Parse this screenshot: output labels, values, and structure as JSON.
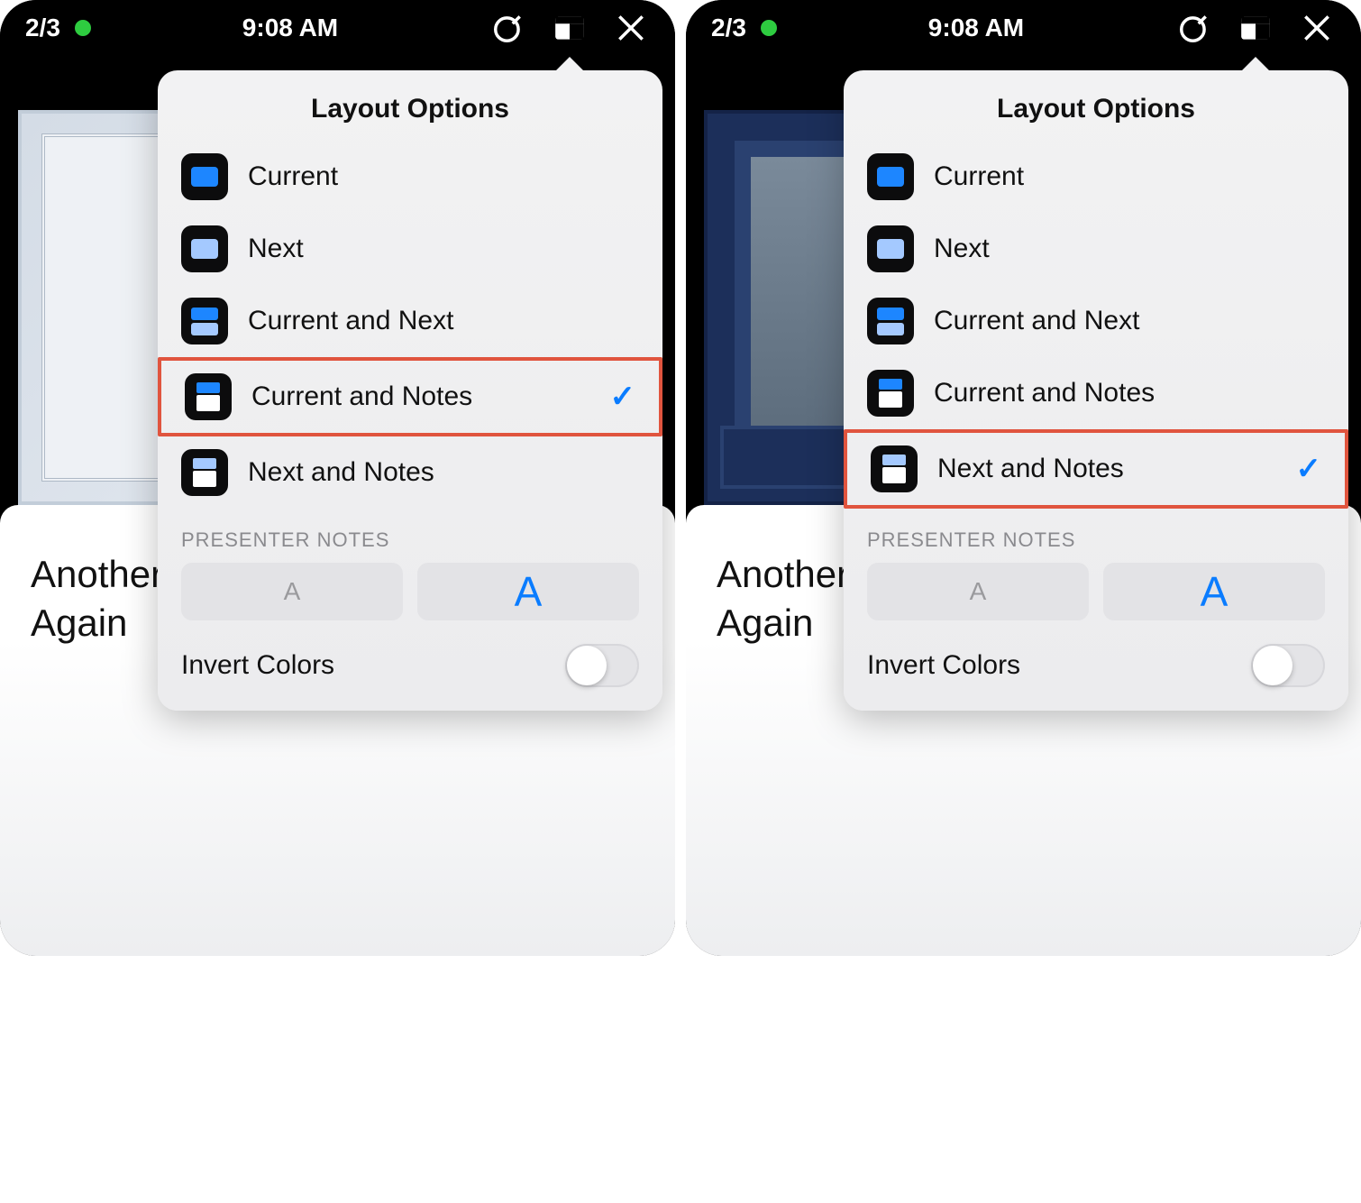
{
  "statusbar": {
    "slide_counter": "2/3",
    "time": "9:08 AM"
  },
  "popover": {
    "title": "Layout Options",
    "options": {
      "current": "Current",
      "next": "Next",
      "current_next": "Current and Next",
      "current_notes": "Current and Notes",
      "next_notes": "Next and Notes"
    },
    "section_label": "PRESENTER NOTES",
    "font_small": "A",
    "font_large": "A",
    "invert_label": "Invert Colors"
  },
  "notes": {
    "line1": "Another",
    "line2": "Again"
  },
  "left": {
    "selected": "current_notes",
    "highlighted": "current_notes"
  },
  "right": {
    "selected": "next_notes",
    "highlighted": "next_notes"
  }
}
